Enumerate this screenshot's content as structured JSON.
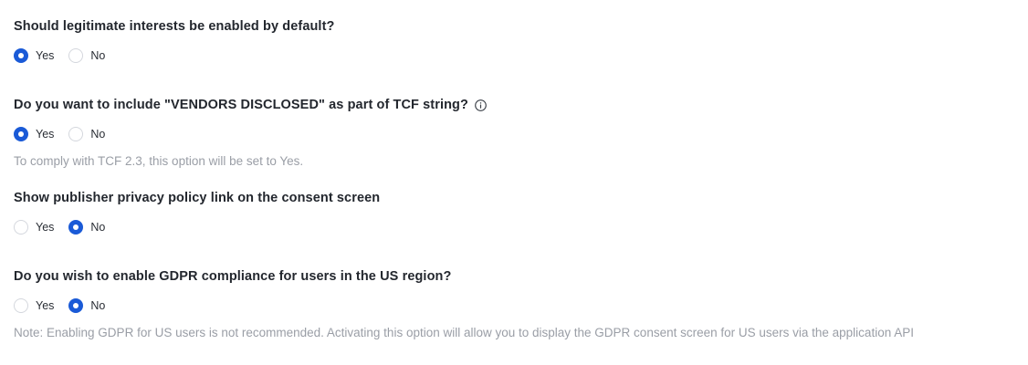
{
  "settings": [
    {
      "question": "Should legitimate interests be enabled by default?",
      "options": [
        "Yes",
        "No"
      ],
      "selected": "Yes",
      "note": ""
    },
    {
      "question": "Do you want to include \"VENDORS DISCLOSED\" as part of TCF string?",
      "has_info_icon": true,
      "options": [
        "Yes",
        "No"
      ],
      "selected": "Yes",
      "note": "To comply with TCF 2.3, this option will be set to Yes."
    },
    {
      "question": "Show publisher privacy policy link on the consent screen",
      "options": [
        "Yes",
        "No"
      ],
      "selected": "No",
      "note": ""
    },
    {
      "question": "Do you wish to enable GDPR compliance for users in the US region?",
      "options": [
        "Yes",
        "No"
      ],
      "selected": "No",
      "note": "Note: Enabling GDPR for US users is not recommended. Activating this option will allow you to display the GDPR consent screen for US users via the application API"
    }
  ],
  "icons": {
    "info": "info-icon"
  },
  "colors": {
    "accent": "#1a5ad7",
    "note_text": "#9a9ea6",
    "question_text": "#23272e"
  }
}
